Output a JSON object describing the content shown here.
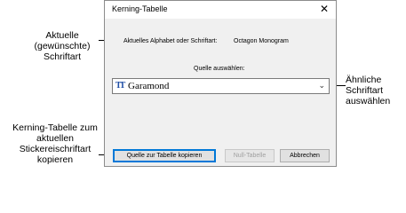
{
  "callouts": {
    "current_font": [
      "Aktuelle",
      "(gewünschte)",
      "Schriftart"
    ],
    "similar_font": [
      "Ähnliche",
      "Schriftart",
      "auswählen"
    ],
    "copy_table": [
      "Kerning-Tabelle zum",
      "aktuellen",
      "Stickereischriftart",
      "kopieren"
    ]
  },
  "dialog": {
    "title": "Kerning-Tabelle",
    "close_glyph": "✕",
    "current_label": "Aktuelles Alphabet oder Schriftart:",
    "current_value": "Octagon Monogram",
    "source_label": "Quelle auswählen:",
    "source_icon": "truetype-icon",
    "source_icon_glyph": "TT",
    "source_value": "Garamond",
    "chevron_glyph": "⌄",
    "buttons": {
      "copy": "Quelle zur Tabelle kopieren",
      "null": "Null-Tabelle",
      "cancel": "Abbrechen"
    }
  }
}
